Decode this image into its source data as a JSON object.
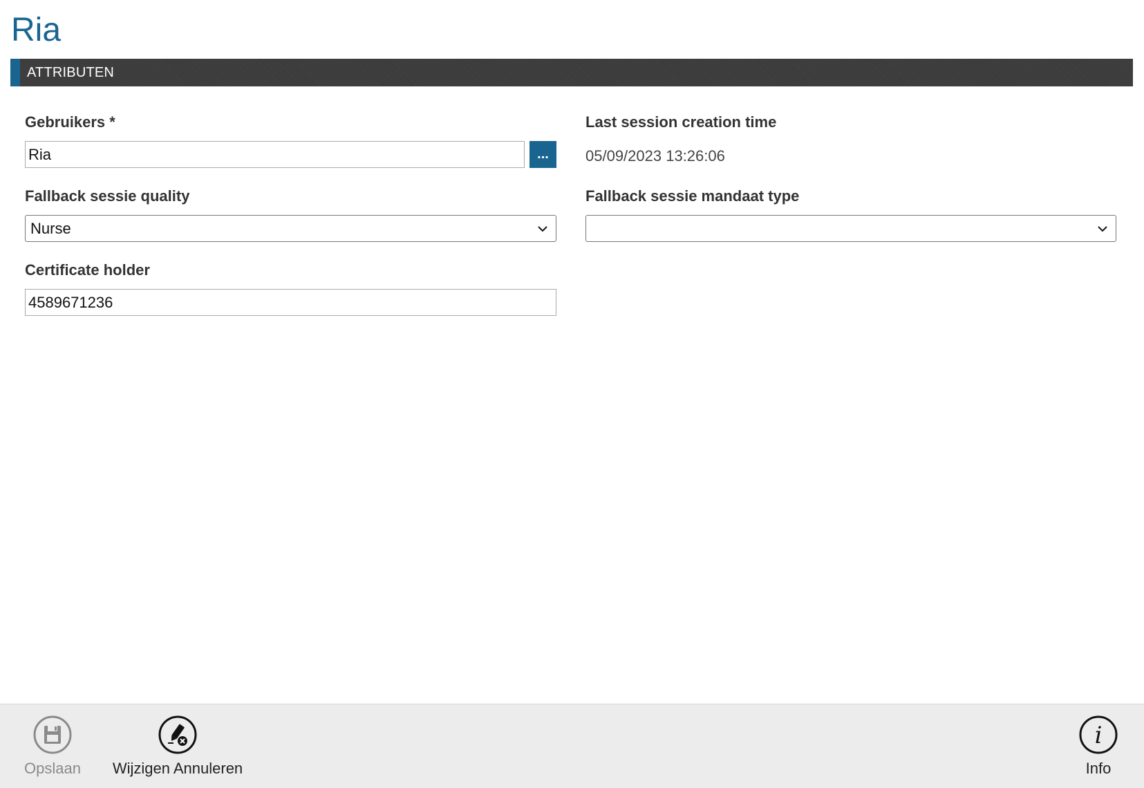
{
  "page": {
    "title": "Ria"
  },
  "section": {
    "header": "ATTRIBUTEN"
  },
  "form": {
    "gebruikers": {
      "label": "Gebruikers *",
      "value": "Ria",
      "browse_label": "..."
    },
    "last_session": {
      "label": "Last session creation time",
      "value": "05/09/2023 13:26:06"
    },
    "fallback_quality": {
      "label": "Fallback sessie quality",
      "selected": "Nurse"
    },
    "fallback_mandaat": {
      "label": "Fallback sessie mandaat type",
      "selected": ""
    },
    "certificate_holder": {
      "label": "Certificate holder",
      "value": "4589671236"
    }
  },
  "toolbar": {
    "save": {
      "label": "Opslaan",
      "icon": "save-icon",
      "enabled": false
    },
    "cancel_edit": {
      "label": "Wijzigen Annuleren",
      "icon": "cancel-edit-icon",
      "enabled": true
    },
    "info": {
      "label": "Info",
      "icon": "info-icon",
      "enabled": true
    }
  },
  "colors": {
    "accent": "#1a6590",
    "header_bg": "#3a3a3a",
    "toolbar_bg": "#ececec",
    "disabled_text": "#8a8a8a"
  }
}
